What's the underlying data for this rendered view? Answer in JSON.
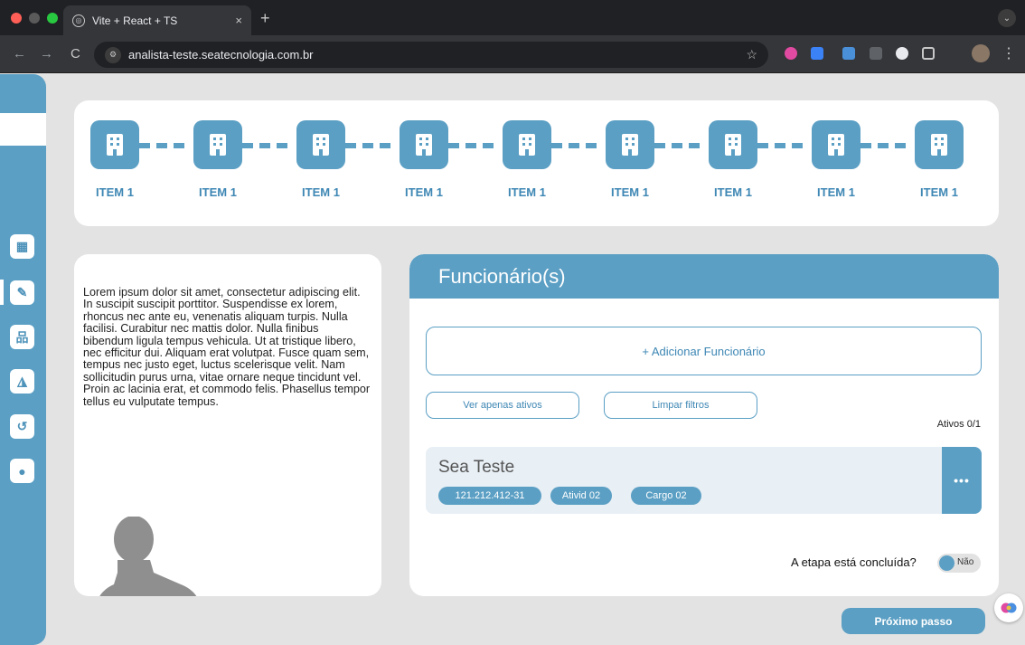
{
  "browser": {
    "tab_title": "Vite + React + TS",
    "tab_close": "×",
    "new_tab": "+",
    "tab_menu": "⌄",
    "url": "analista-teste.seatecnologia.com.br",
    "back": "←",
    "forward": "→",
    "reload": "C",
    "star": "☆",
    "menu": "⋮"
  },
  "sidebar": {
    "items": [
      {
        "icon": "building-icon",
        "glyph": "▦"
      },
      {
        "icon": "edit-icon",
        "glyph": "✎"
      },
      {
        "icon": "org-chart-icon",
        "glyph": "品"
      },
      {
        "icon": "notification-icon",
        "glyph": "◮"
      },
      {
        "icon": "history-icon",
        "glyph": "↺"
      },
      {
        "icon": "user-icon",
        "glyph": "●"
      }
    ]
  },
  "stepper": {
    "steps": [
      {
        "label": "ITEM 1"
      },
      {
        "label": "ITEM 1"
      },
      {
        "label": "ITEM 1"
      },
      {
        "label": "ITEM 1"
      },
      {
        "label": "ITEM 1"
      },
      {
        "label": "ITEM 1"
      },
      {
        "label": "ITEM 1"
      },
      {
        "label": "ITEM 1"
      },
      {
        "label": "ITEM 1"
      }
    ]
  },
  "info": {
    "text": "Lorem ipsum dolor sit amet, consectetur adipiscing elit. In suscipit suscipit porttitor. Suspendisse ex lorem, rhoncus nec ante eu, venenatis aliquam turpis. Nulla facilisi. Curabitur nec mattis dolor. Nulla finibus bibendum ligula tempus vehicula. Ut at tristique libero, nec efficitur dui. Aliquam erat volutpat. Fusce quam sem, tempus nec justo eget, luctus scelerisque velit. Nam sollicitudin purus urna, vitae ornare neque tincidunt vel. Proin ac lacinia erat, et commodo felis. Phasellus tempor tellus eu vulputate tempus."
  },
  "employees": {
    "title": "Funcionário(s)",
    "add_label": "+ Adicionar Funcionário",
    "filter_active_label": "Ver apenas ativos",
    "clear_filters_label": "Limpar filtros",
    "active_count": "Ativos 0/1",
    "list": [
      {
        "name": "Sea Teste",
        "cpf": "121.212.412-31",
        "activity": "Ativid 02",
        "role": "Cargo 02",
        "menu": "•••"
      }
    ],
    "completion_question": "A etapa está concluída?",
    "completion_value": "Não"
  },
  "footer": {
    "next_label": "Próximo passo"
  },
  "colors": {
    "accent": "#5b9fc4",
    "accent_text": "#3e87b4",
    "background": "#e3e3e3"
  }
}
